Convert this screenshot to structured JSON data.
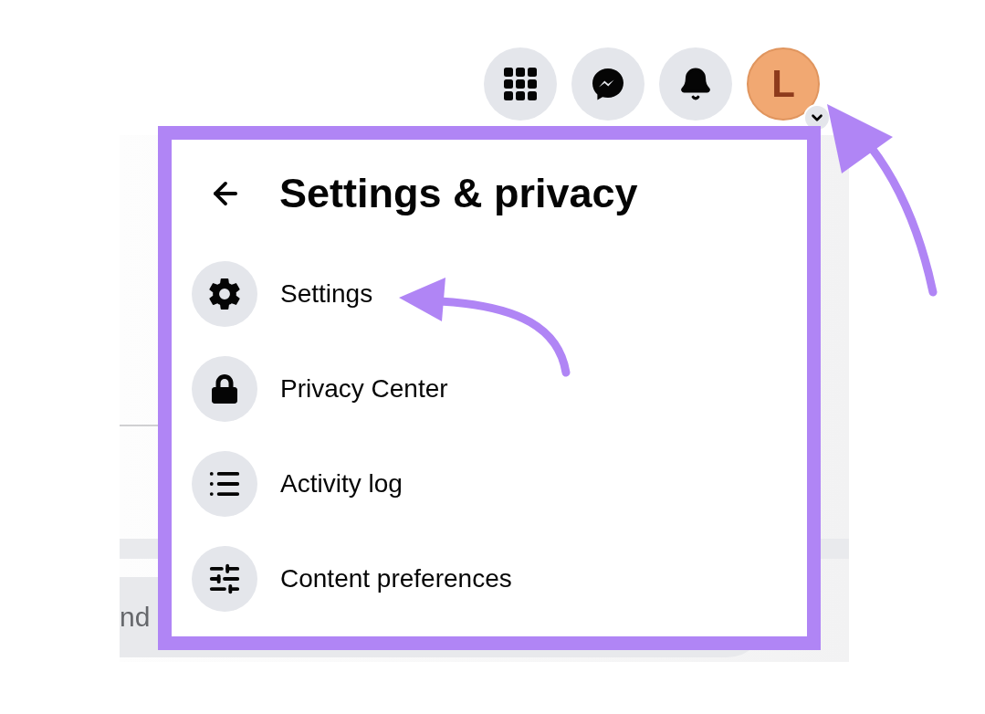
{
  "top_bar": {
    "buttons": [
      {
        "kind": "apps"
      },
      {
        "kind": "messenger"
      },
      {
        "kind": "notifications"
      }
    ],
    "avatar": {
      "initial": "L"
    }
  },
  "background": {
    "composer_placeholder": "nd"
  },
  "menu": {
    "title": "Settings & privacy",
    "items": [
      {
        "label": "Settings",
        "kind": "settings"
      },
      {
        "label": "Privacy Center",
        "kind": "privacy"
      },
      {
        "label": "Activity log",
        "kind": "activity"
      },
      {
        "label": "Content preferences",
        "kind": "preferences"
      }
    ]
  }
}
